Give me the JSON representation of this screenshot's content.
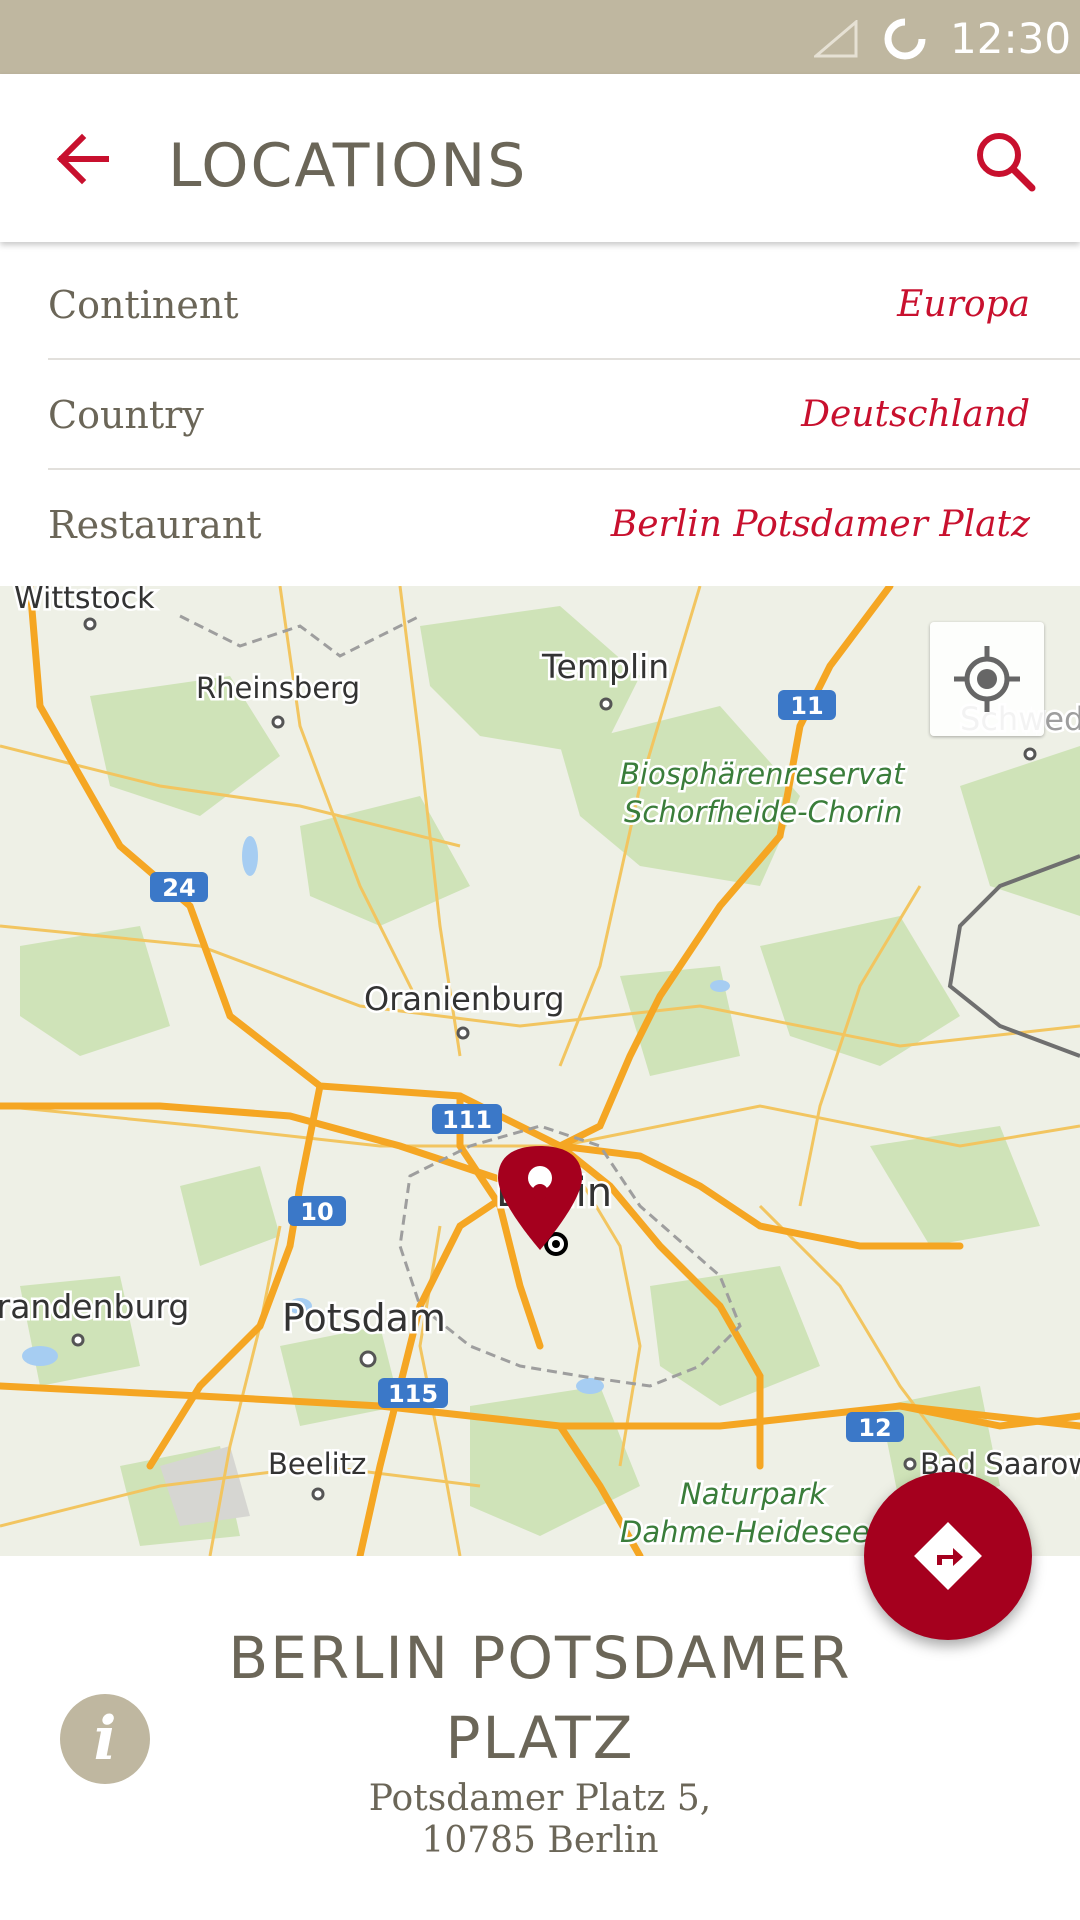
{
  "status_bar": {
    "time": "12:30",
    "icons": [
      "cell-signal-icon",
      "sync-icon"
    ]
  },
  "app_bar": {
    "title": "LOCATIONS",
    "back_icon": "arrow-back-icon",
    "search_icon": "search-icon"
  },
  "filters": [
    {
      "label": "Continent",
      "value": "Europa"
    },
    {
      "label": "Country",
      "value": "Deutschland"
    },
    {
      "label": "Restaurant",
      "value": "Berlin Potsdamer Platz"
    }
  ],
  "map": {
    "locate_icon": "my-location-icon",
    "marker_icon": "map-pin-icon",
    "labels": {
      "wittstock": "Wittstock",
      "rheinsberg": "Rheinsberg",
      "templin": "Templin",
      "biosphere_1": "Biosphärenreservat",
      "biosphere_2": "Schorfheide-Chorin",
      "schwedt": "Schwed",
      "oranienburg": "Oranienburg",
      "berlin": "Berlin",
      "brandenburg": "Brandenburg",
      "potsdam": "Potsdam",
      "beelitz": "Beelitz",
      "bad_saarow": "Bad Saarow",
      "naturpark_1": "Naturpark",
      "naturpark_2": "Dahme-Heideseen"
    },
    "shields": {
      "a24": "24",
      "a11": "11",
      "a111": "111",
      "a10": "10",
      "a115": "115",
      "a12": "12"
    },
    "colors": {
      "land": "#eef0e6",
      "forest": "#cfe3b8",
      "water": "#a6cdf2",
      "highway": "#f5a623",
      "minor_road": "#f2c560",
      "shield": "#3b78c8"
    }
  },
  "location": {
    "name": "BERLIN POTSDAMER PLATZ",
    "address_line1": "Potsdamer Platz 5,",
    "address_line2": "10785 Berlin",
    "info_icon": "info-icon",
    "info_glyph": "i"
  },
  "fab": {
    "icon": "directions-icon"
  },
  "colors": {
    "status_bar": "#bfb7a0",
    "accent_red": "#c8102e",
    "fab_red": "#a5001e",
    "text_grey": "#6b6658"
  }
}
